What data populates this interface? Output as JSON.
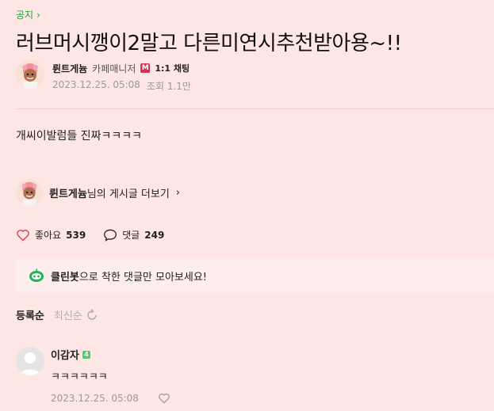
{
  "board": {
    "label": "공지"
  },
  "post": {
    "title": "러브머시깽이2말고 다른미연시추천받아용~!!",
    "body": "개씨이발럼들 진짜ㅋㅋㅋㅋ",
    "author": {
      "name": "륀트게늄",
      "role": "카페매니저",
      "role_badge": "M",
      "chat": "1:1 채팅"
    },
    "date": "2023.12.25. 05:08",
    "views": "조회 1.1만"
  },
  "more_posts": {
    "author": "륀트게늄",
    "suffix": "님의 게시글 더보기"
  },
  "actions": {
    "like_label": "좋아요",
    "like_count": "539",
    "comment_label": "댓글",
    "comment_count": "249"
  },
  "cleanbot": {
    "bold": "클린봇",
    "text": "으로 착한 댓글만 모아보세요!"
  },
  "sort": {
    "active": "등록순",
    "inactive": "최신순"
  },
  "comments": [
    {
      "name": "이감자",
      "level_badge": "4",
      "text": "ㅋㅋㅋㅋㅋㅋ",
      "date": "2023.12.25. 05:08"
    }
  ],
  "colors": {
    "background": "#fde6e4",
    "accent_green": "#1fa33a",
    "manager_badge": "#d8325a"
  }
}
